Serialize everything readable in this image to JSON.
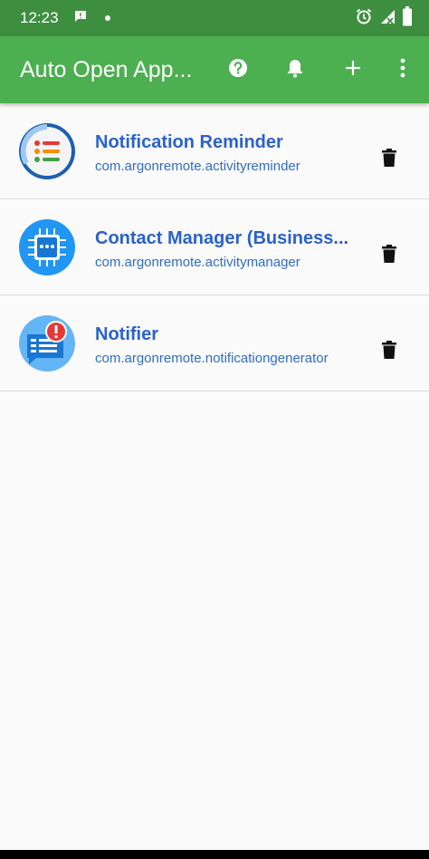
{
  "status_bar": {
    "time": "12:23",
    "left_icons": [
      "message-icon",
      "dot-icon"
    ],
    "right_icons": [
      "alarm-icon",
      "signal-icon",
      "battery-icon"
    ]
  },
  "app_bar": {
    "title": "Auto Open App...",
    "actions": [
      "help-icon",
      "bell-icon",
      "add-icon",
      "overflow-menu-icon"
    ],
    "color": "#4caf50"
  },
  "apps": [
    {
      "name": "Notification Reminder",
      "package": "com.argonremote.activityreminder",
      "icon": "list-icon"
    },
    {
      "name": "Contact Manager (Business...",
      "package": "com.argonremote.activitymanager",
      "icon": "chip-chat-icon"
    },
    {
      "name": "Notifier",
      "package": "com.argonremote.notificationgenerator",
      "icon": "alert-chat-icon"
    }
  ],
  "colors": {
    "title": "#2a62c9",
    "package": "#2f6ec2",
    "status_bar": "#3e8e3f"
  }
}
